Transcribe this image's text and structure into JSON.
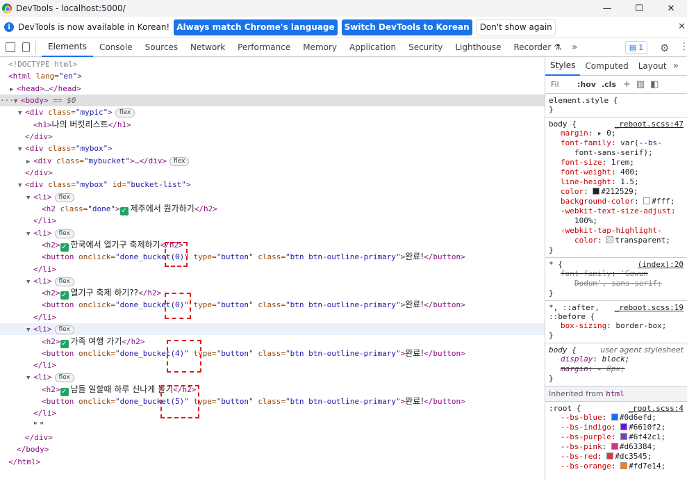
{
  "window": {
    "title": "DevTools - localhost:5000/",
    "minimize": "—",
    "maximize": "☐",
    "close": "✕"
  },
  "infobar": {
    "message": "DevTools is now available in Korean!",
    "btn_match": "Always match Chrome's language",
    "btn_switch": "Switch DevTools to Korean",
    "btn_dont_show": "Don't show again",
    "close": "✕"
  },
  "tabs": [
    "Elements",
    "Console",
    "Sources",
    "Network",
    "Performance",
    "Memory",
    "Application",
    "Security",
    "Lighthouse",
    "Recorder ⚗"
  ],
  "active_tab": "Elements",
  "issues_count": "1",
  "dom": {
    "doctype": "<!DOCTYPE html>",
    "html_open_tag": "<html",
    "html_lang_attr": " lang=",
    "html_lang_val": "\"en\"",
    "html_open_end": ">",
    "head": "<head>",
    "head_dots": "…",
    "head_close": "</head>",
    "body_open": "<body>",
    "body_eq": " == $0",
    "mypic_open": "<div",
    "class_attr": " class=",
    "mypic_class": "\"mypic\"",
    "tag_end": ">",
    "flex": "flex",
    "h1_open": "<h1>",
    "h1_text": "나의 버킷리스트",
    "h1_close": "</h1>",
    "div_close": "</div>",
    "mybox_class": "\"mybox\"",
    "mybucket_class": "\"mybucket\"",
    "id_attr": " id=",
    "bucket_list_id": "\"bucket-list\"",
    "li_open": "<li>",
    "li_close": "</li>",
    "h2_done_open": "<h2",
    "done_class": "\"done\"",
    "h2_open": "<h2>",
    "h2_close": "</h2>",
    "button_open": "<button",
    "onclick_attr": " onclick=",
    "type_attr": " type=",
    "type_val": "\"button\"",
    "btn_class_val": "\"btn btn-outline-primary\"",
    "button_text": "완료!",
    "button_close": "</button>",
    "empty_text": "\" \"",
    "body_close": "</body>",
    "html_close": "</html>",
    "items": [
      {
        "text": "제주에서 뭔가하기",
        "onclick": ""
      },
      {
        "text": "한국에서 열기구 축제하기",
        "onclick": "\"done_bucket(0)\""
      },
      {
        "text": "열기구 축제 하기??",
        "onclick": "\"done_bucket(0)\""
      },
      {
        "text": "가족 여행 가기",
        "onclick": "\"done_bucket(4)\""
      },
      {
        "text": "남들 일할때 하루 신나게 놀기",
        "onclick": "\"done_bucket(5)\""
      }
    ]
  },
  "styles_pane": {
    "tabs": [
      "Styles",
      "Computed",
      "Layout"
    ],
    "filter_placeholder": "Fil",
    "hov": ":hov",
    "cls": ".cls",
    "element_style": "element.style {",
    "close_brace": "}",
    "body_rule": {
      "selector": "body {",
      "source": "_reboot.scss:47",
      "decls": [
        {
          "p": "margin",
          "v": "▸ 0;"
        },
        {
          "p": "font-family",
          "v": "var(",
          "var": "--bs-",
          "cont": "font-sans-serif",
          "tail": ");"
        },
        {
          "p": "font-size",
          "v": "1rem;"
        },
        {
          "p": "font-weight",
          "v": "400;"
        },
        {
          "p": "line-height",
          "v": "1.5;"
        },
        {
          "p": "color",
          "v": "#212529;",
          "swatch": "#212529"
        },
        {
          "p": "background-color",
          "v": "#fff;",
          "swatch": "#ffffff"
        },
        {
          "p": "-webkit-text-size-adjust",
          "v": "",
          "cont": "100%;"
        },
        {
          "p": "-webkit-tap-highlight-",
          "v": "",
          "cont": "color:",
          "cont_v": "transparent;",
          "swatch": "transparent"
        }
      ]
    },
    "star_rule": {
      "selector": "* {",
      "source": "(index):20",
      "p": "font-family",
      "v": "'Gowun",
      "cont": "Dodum', sans-serif;"
    },
    "pseudo_rule": {
      "selector": "*, ::after,",
      "selector2": "::before {",
      "source": "_reboot.scss:19",
      "p": "box-sizing",
      "v": "border-box;"
    },
    "ua_rule": {
      "selector": "body {",
      "source": "user agent stylesheet",
      "decls": [
        {
          "p": "display",
          "v": "block;"
        },
        {
          "p": "margin",
          "v": "▸ 8px;"
        }
      ]
    },
    "inherited_label": "Inherited from",
    "inherited_tag": "html",
    "root_rule": {
      "selector": ":root {",
      "source": "_root.scss:4",
      "vars": [
        {
          "p": "--bs-blue",
          "v": "#0d6efd;",
          "color": "#0d6efd"
        },
        {
          "p": "--bs-indigo",
          "v": "#6610f2;",
          "color": "#6610f2"
        },
        {
          "p": "--bs-purple",
          "v": "#6f42c1;",
          "color": "#6f42c1"
        },
        {
          "p": "--bs-pink",
          "v": "#d63384;",
          "color": "#d63384"
        },
        {
          "p": "--bs-red",
          "v": "#dc3545;",
          "color": "#dc3545"
        },
        {
          "p": "--bs-orange",
          "v": "#fd7e14;",
          "color": "#fd7e14"
        }
      ]
    }
  }
}
